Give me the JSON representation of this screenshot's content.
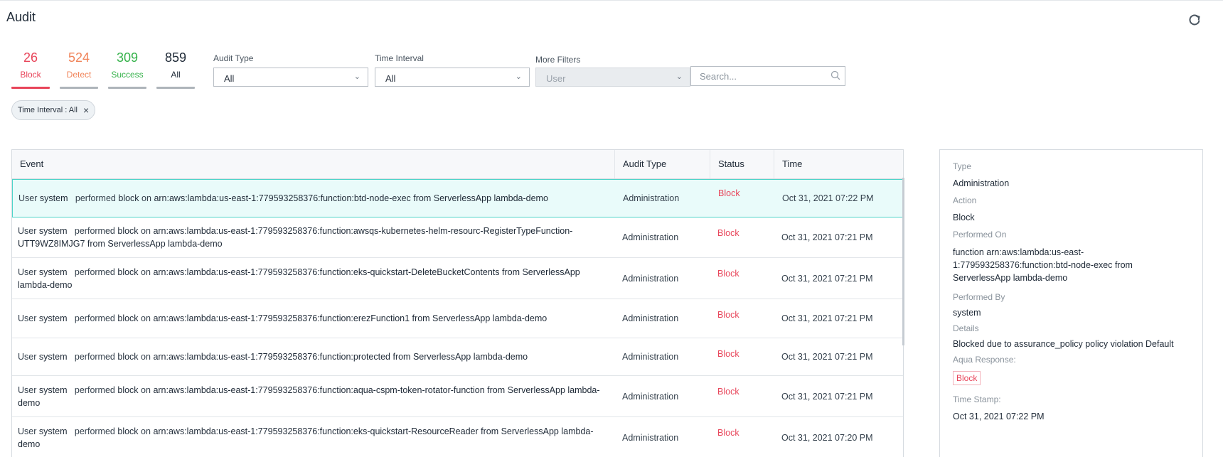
{
  "page": {
    "title": "Audit"
  },
  "counters": [
    {
      "count": "26",
      "label": "Block"
    },
    {
      "count": "524",
      "label": "Detect"
    },
    {
      "count": "309",
      "label": "Success"
    },
    {
      "count": "859",
      "label": "All"
    }
  ],
  "filters": {
    "audit_type": {
      "label": "Audit Type",
      "value": "All"
    },
    "time_interval": {
      "label": "Time Interval",
      "value": "All"
    },
    "more_filters": {
      "label": "More Filters",
      "value": "User"
    },
    "search": {
      "placeholder": "Search...",
      "value": ""
    }
  },
  "active_filter_chip": "Time Interval : All",
  "table": {
    "columns": [
      "Event",
      "Audit Type",
      "Status",
      "Time"
    ],
    "rows": [
      {
        "user": "system",
        "action": "block",
        "target": "arn:aws:lambda:us-east-1:779593258376:function:btd-node-exec from ServerlessApp lambda-demo",
        "audit_type": "Administration",
        "status": "Block",
        "time": "Oct 31, 2021 07:22 PM"
      },
      {
        "user": "system",
        "action": "block",
        "target": "arn:aws:lambda:us-east-1:779593258376:function:awsqs-kubernetes-helm-resourc-RegisterTypeFunction-UTT9WZ8IMJG7 from ServerlessApp lambda-demo",
        "audit_type": "Administration",
        "status": "Block",
        "time": "Oct 31, 2021 07:21 PM"
      },
      {
        "user": "system",
        "action": "block",
        "target": "arn:aws:lambda:us-east-1:779593258376:function:eks-quickstart-DeleteBucketContents from ServerlessApp lambda-demo",
        "audit_type": "Administration",
        "status": "Block",
        "time": "Oct 31, 2021 07:21 PM"
      },
      {
        "user": "system",
        "action": "block",
        "target": "arn:aws:lambda:us-east-1:779593258376:function:erezFunction1 from ServerlessApp lambda-demo",
        "audit_type": "Administration",
        "status": "Block",
        "time": "Oct 31, 2021 07:21 PM"
      },
      {
        "user": "system",
        "action": "block",
        "target": "arn:aws:lambda:us-east-1:779593258376:function:protected from ServerlessApp lambda-demo",
        "audit_type": "Administration",
        "status": "Block",
        "time": "Oct 31, 2021 07:21 PM"
      },
      {
        "user": "system",
        "action": "block",
        "target": "arn:aws:lambda:us-east-1:779593258376:function:aqua-cspm-token-rotator-function from ServerlessApp lambda-demo",
        "audit_type": "Administration",
        "status": "Block",
        "time": "Oct 31, 2021 07:21 PM"
      },
      {
        "user": "system",
        "action": "block",
        "target": "arn:aws:lambda:us-east-1:779593258376:function:eks-quickstart-ResourceReader from ServerlessApp lambda-demo",
        "audit_type": "Administration",
        "status": "Block",
        "time": "Oct 31, 2021 07:20 PM"
      }
    ]
  },
  "event_words": {
    "user": "User",
    "performed": "performed",
    "on": "on"
  },
  "details": {
    "type_label": "Type",
    "type_value": "Administration",
    "action_label": "Action",
    "action_value": "Block",
    "performed_on_label": "Performed On",
    "performed_on_value": "function arn:aws:lambda:us-east-1:779593258376:function:btd-node-exec from ServerlessApp lambda-demo",
    "performed_by_label": "Performed By",
    "performed_by_value": "system",
    "details_label": "Details",
    "details_value": "Blocked due to assurance_policy policy violation Default",
    "response_label": "Aqua Response:",
    "response_value": "Block",
    "timestamp_label": "Time Stamp:",
    "timestamp_value": "Oct 31, 2021 07:22 PM"
  },
  "colors": {
    "block": "#e8455a",
    "detect": "#f0845a",
    "success": "#35b24a",
    "selected_row_border": "#4dd3c8"
  },
  "icons": {
    "refresh": "refresh-icon",
    "search": "search-icon",
    "chevron": "chevron-down-icon",
    "close": "close-icon"
  }
}
